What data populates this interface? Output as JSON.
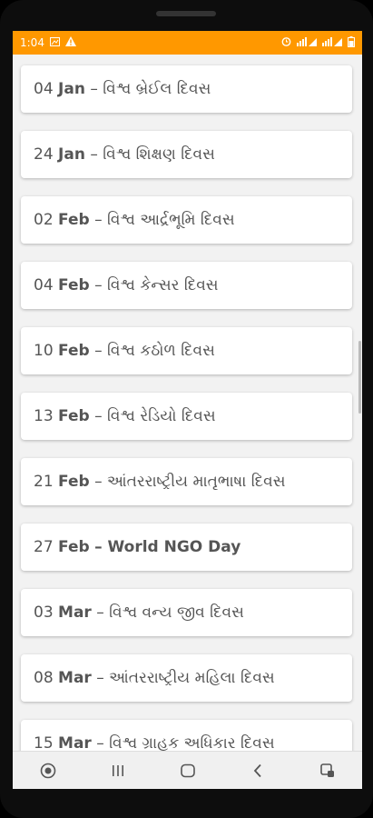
{
  "status": {
    "time": "1:04",
    "left_icons": [
      "image-icon",
      "warning-icon"
    ],
    "right_icons": [
      "alarm-icon",
      "signal-icon",
      "signal-icon",
      "battery-icon"
    ]
  },
  "items": [
    {
      "day": "04",
      "month": "Jan",
      "title": "– વિશ્વ બ્રેઈલ દિવસ"
    },
    {
      "day": "24",
      "month": "Jan",
      "title": "– વિશ્વ શિક્ષણ દિવસ"
    },
    {
      "day": "02",
      "month": "Feb",
      "title": "– વિશ્વ આર્દ્રભૂમિ દિવસ"
    },
    {
      "day": "04",
      "month": "Feb",
      "title": "– વિશ્વ કેન્સર દિવસ"
    },
    {
      "day": "10",
      "month": "Feb",
      "title": "– વિશ્વ કઠોળ દિવસ"
    },
    {
      "day": "13",
      "month": "Feb",
      "title": "– વિશ્વ રેડિયો દિવસ"
    },
    {
      "day": "21",
      "month": "Feb",
      "title": "– આંતરરાષ્ટ્રીય માતૃભાષા દિવસ"
    },
    {
      "day": "27",
      "month": "Feb",
      "title": "– World NGO Day"
    },
    {
      "day": "03",
      "month": "Mar",
      "title": "– વિશ્વ વન્ય જીવ દિવસ"
    },
    {
      "day": "08",
      "month": "Mar",
      "title": "– આંતરરાષ્ટ્રીય મહિલા દિવસ"
    },
    {
      "day": "15",
      "month": "Mar",
      "title": "– વિશ્વ ગ્રાહક અધિકાર દિવસ"
    }
  ],
  "navbar": [
    "accessibility-icon",
    "recents-icon",
    "home-icon",
    "back-icon",
    "keyboard-icon"
  ],
  "colors": {
    "status_bar": "#ff9800",
    "card_text": "#555555"
  }
}
